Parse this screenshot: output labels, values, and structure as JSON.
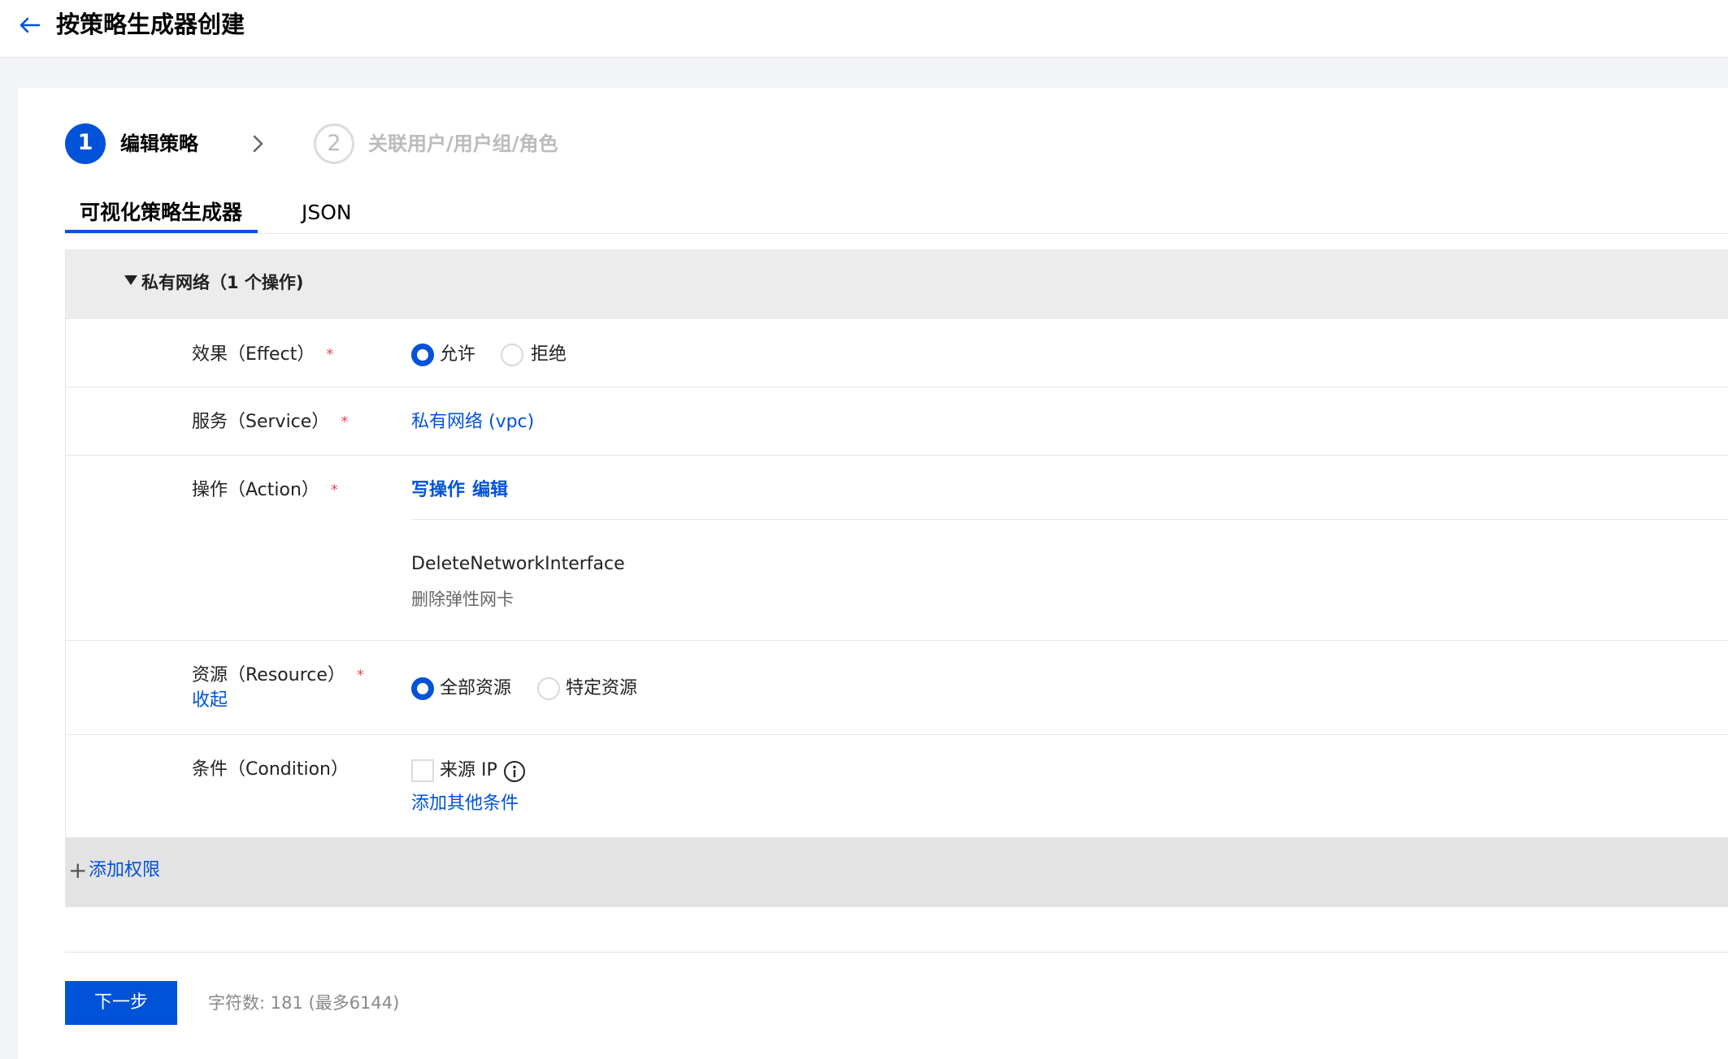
{
  "header": {
    "title": "按策略生成器创建",
    "back_icon": "arrow-left-icon"
  },
  "steps": [
    {
      "number": "1",
      "label": "编辑策略",
      "state": "active"
    },
    {
      "number": "2",
      "label": "关联用户/用户组/角色",
      "state": "pending"
    }
  ],
  "tabs": [
    {
      "label": "可视化策略生成器",
      "active": true
    },
    {
      "label": "JSON",
      "active": false
    }
  ],
  "section": {
    "title": "私有网络（1 个操作)",
    "effect": {
      "label": "效果（Effect）",
      "required": "*",
      "options": [
        "允许",
        "拒绝"
      ],
      "selected": "允许"
    },
    "service": {
      "label": "服务（Service）",
      "required": "*",
      "value": "私有网络 (vpc)"
    },
    "action": {
      "label": "操作（Action）",
      "required": "*",
      "type_link": "写操作",
      "edit_link": "编辑",
      "name": "DeleteNetworkInterface",
      "description": "删除弹性网卡"
    },
    "resource": {
      "label": "资源（Resource）",
      "required": "*",
      "collapse_link": "收起",
      "options": [
        "全部资源",
        "特定资源"
      ],
      "selected": "全部资源"
    },
    "condition": {
      "label": "条件（Condition）",
      "checkbox_label": "来源 IP",
      "checked": false,
      "add_link": "添加其他条件"
    }
  },
  "add_permission": {
    "plus": "+",
    "label": "添加权限"
  },
  "footer": {
    "next_label": "下一步",
    "char_count": "字符数: 181 (最多6144)"
  },
  "colors": {
    "primary": "#0052d9",
    "required": "#e34d59",
    "section_bg": "#ececec"
  }
}
